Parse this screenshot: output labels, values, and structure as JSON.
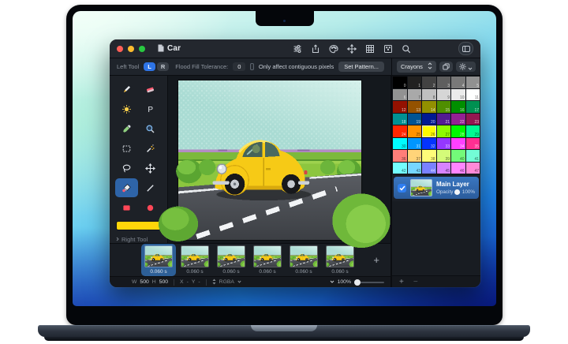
{
  "titlebar": {
    "title": "Car",
    "icons": [
      "tool-settings",
      "share",
      "palette",
      "move",
      "grid",
      "pattern",
      "search",
      "sidebar-toggle"
    ]
  },
  "options_bar": {
    "left_tool_label": "Left Tool",
    "left_button": "L",
    "right_button": "R",
    "tolerance_label": "Flood Fill Tolerance:",
    "tolerance_value": "0",
    "contiguous_checkbox_label": "Only affect contiguous pixels",
    "contiguous_checked": false,
    "set_pattern_button": "Set Pattern..."
  },
  "palette_panel": {
    "selector_value": "Crayons",
    "selected_index": 26,
    "colors": [
      "#000000",
      "#212121",
      "#424242",
      "#5E5E5E",
      "#797979",
      "#919191",
      "#929292",
      "#A9A9A9",
      "#C0C0C0",
      "#D6D6D6",
      "#EBEBEB",
      "#FFFFFF",
      "#941100",
      "#945200",
      "#929000",
      "#4F8F00",
      "#008F00",
      "#009051",
      "#009193",
      "#005493",
      "#011993",
      "#531B93",
      "#942193",
      "#941751",
      "#FF2600",
      "#FF9300",
      "#FFFB00",
      "#8EFA00",
      "#00F900",
      "#00FA92",
      "#00FDFF",
      "#0096FF",
      "#0433FF",
      "#9437FF",
      "#FF40FF",
      "#FF2F92",
      "#FF7E79",
      "#FFD479",
      "#FFFC79",
      "#D4FB79",
      "#73FA79",
      "#73FCD6",
      "#73FDFF",
      "#76D6FF",
      "#7A81FF",
      "#D783FF",
      "#FF85FF",
      "#FF8AD8"
    ]
  },
  "tools_panel": {
    "right_tool_label": "Right Tool",
    "current_color": "#FFD60A",
    "selected_tool": "flood-fill",
    "tools": [
      "pencil",
      "eraser",
      "brightness",
      "pattern-stamp",
      "eyedropper",
      "zoom",
      "rect-select",
      "magic-wand",
      "lasso",
      "move",
      "flood-fill",
      "line",
      "rectangle",
      "ellipse"
    ]
  },
  "layers_panel": {
    "layers": [
      {
        "name": "Main Layer",
        "opacity_label": "Opacity",
        "opacity_value": "100%",
        "visible": true
      }
    ],
    "add_button": "+",
    "remove_button": "−"
  },
  "animation": {
    "frames": [
      {
        "duration": "0.060 s",
        "selected": true
      },
      {
        "duration": "0.060 s",
        "selected": false
      },
      {
        "duration": "0.060 s",
        "selected": false
      },
      {
        "duration": "0.060 s",
        "selected": false
      },
      {
        "duration": "0.060 s",
        "selected": false
      },
      {
        "duration": "0.060 s",
        "selected": false
      }
    ],
    "add_frame_button": "+"
  },
  "status_bar": {
    "width_label": "W",
    "width_value": "500",
    "height_label": "H",
    "height_value": "500",
    "x_label": "X",
    "x_value": "-",
    "y_label": "Y",
    "y_value": "-",
    "color_mode": "RGBA",
    "zoom_value": "100%"
  },
  "artwork_colors": {
    "sky": "#A9DBD3",
    "sky_dither": "#CFEEE7",
    "horizon": "#B38CC4",
    "hedge": "#7CB93C",
    "field": "#8CC63F",
    "bush_dark": "#5AA531",
    "bush_light": "#79C243",
    "road_dark": "#3C3F44",
    "road_light": "#5A5D63",
    "lane_marking": "#F2F4F6",
    "car_body": "#F6CA16",
    "car_shade": "#D8A90D",
    "car_highlight": "#FFE45E",
    "car_window": "#45635A",
    "tire": "#17181B",
    "chrome": "#CCD1D7"
  }
}
